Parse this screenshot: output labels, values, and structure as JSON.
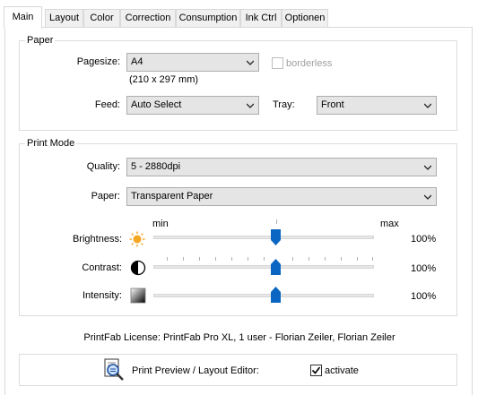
{
  "tabs": [
    {
      "label": "Main",
      "active": true
    },
    {
      "label": "Layout"
    },
    {
      "label": "Color"
    },
    {
      "label": "Correction"
    },
    {
      "label": "Consumption"
    },
    {
      "label": "Ink Ctrl"
    },
    {
      "label": "Optionen"
    }
  ],
  "paper": {
    "title": "Paper",
    "pagesize_label": "Pagesize:",
    "pagesize_value": "A4",
    "pagesize_dims": "(210 x 297 mm)",
    "borderless_label": "borderless",
    "borderless_checked": false,
    "borderless_enabled": false,
    "feed_label": "Feed:",
    "feed_value": "Auto Select",
    "tray_label": "Tray:",
    "tray_value": "Front"
  },
  "print_mode": {
    "title": "Print Mode",
    "quality_label": "Quality:",
    "quality_value": "5 - 2880dpi",
    "paper_label": "Paper:",
    "paper_value": "Transparent Paper",
    "scale_min": "min",
    "scale_max": "max",
    "brightness": {
      "label": "Brightness:",
      "value_text": "100%",
      "icon": "sun-icon"
    },
    "contrast": {
      "label": "Contrast:",
      "value_text": "100%",
      "icon": "contrast-icon"
    },
    "intensity": {
      "label": "Intensity:",
      "value_text": "100%",
      "icon": "gradient-icon"
    }
  },
  "license_text": "PrintFab License: PrintFab Pro XL, 1 user - Florian Zeiler, Florian Zeiler",
  "preview": {
    "icon": "magnifier-document-icon",
    "label": "Print Preview / Layout Editor:",
    "activate_label": "activate",
    "activate_checked": true
  },
  "colors": {
    "accent_blue": "#0a66c2",
    "sun_orange": "#f5a623"
  }
}
